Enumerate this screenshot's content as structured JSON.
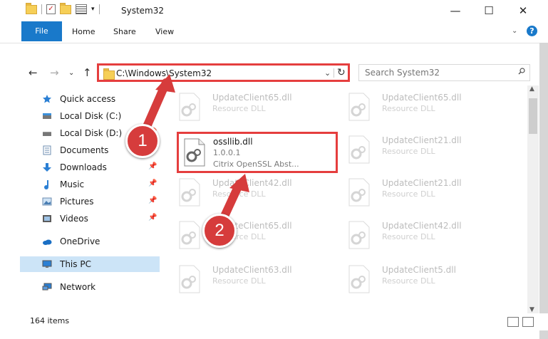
{
  "window": {
    "title": "System32",
    "controls": {
      "minimize": "—",
      "maximize": "☐",
      "close": "✕"
    }
  },
  "ribbon": {
    "tabs": [
      "File",
      "Home",
      "Share",
      "View"
    ],
    "collapse": "⌄",
    "help": "?"
  },
  "nav": {
    "back": "←",
    "forward": "→",
    "recent": "⌄",
    "up": "↑",
    "address": "C:\\Windows\\System32",
    "dropdown": "⌄",
    "refresh": "↻",
    "search_placeholder": "Search System32"
  },
  "sidebar": {
    "items": [
      {
        "label": "Quick access",
        "icon": "star-icon",
        "pinned": false
      },
      {
        "label": "Local Disk (C:)",
        "icon": "drive-icon",
        "pinned": true
      },
      {
        "label": "Local Disk (D:)",
        "icon": "drive-icon",
        "pinned": true
      },
      {
        "label": "Documents",
        "icon": "document-icon",
        "pinned": true
      },
      {
        "label": "Downloads",
        "icon": "download-icon",
        "pinned": true
      },
      {
        "label": "Music",
        "icon": "music-icon",
        "pinned": true
      },
      {
        "label": "Pictures",
        "icon": "pictures-icon",
        "pinned": true
      },
      {
        "label": "Videos",
        "icon": "video-icon",
        "pinned": true
      },
      {
        "label": "OneDrive",
        "icon": "cloud-icon",
        "pinned": false
      },
      {
        "label": "This PC",
        "icon": "computer-icon",
        "pinned": false
      },
      {
        "label": "Network",
        "icon": "network-icon",
        "pinned": false
      }
    ],
    "pin_glyph": "📌"
  },
  "files": {
    "left_column": [
      {
        "name": "UpdateClient65.dll",
        "type": "Resource DLL"
      },
      {
        "name": "ossllib.dll",
        "type": "Citrix OpenSSL Abst...",
        "version": "1.0.0.1"
      },
      {
        "name": "UpdateClient42.dll",
        "type": "Resource DLL"
      },
      {
        "name": "UpdateClient65.dll",
        "type": "Resource DLL"
      },
      {
        "name": "UpdateClient63.dll",
        "type": "Resource DLL"
      }
    ],
    "right_column": [
      {
        "name": "UpdateClient65.dll",
        "type": "Resource DLL"
      },
      {
        "name": "UpdateClient21.dll",
        "type": "Resource DLL"
      },
      {
        "name": "UpdateClient21.dll",
        "type": "Resource DLL"
      },
      {
        "name": "UpdateClient42.dll",
        "type": "Resource DLL"
      },
      {
        "name": "UpdateClient5.dll",
        "type": "Resource DLL"
      }
    ]
  },
  "annotations": {
    "badge1": "1",
    "badge2": "2",
    "color": "#d63c3c"
  },
  "status": {
    "item_count": "164 items"
  },
  "colors": {
    "accent": "#1979ca",
    "highlight_border": "#e53e3e",
    "selected": "#cce4f7"
  }
}
